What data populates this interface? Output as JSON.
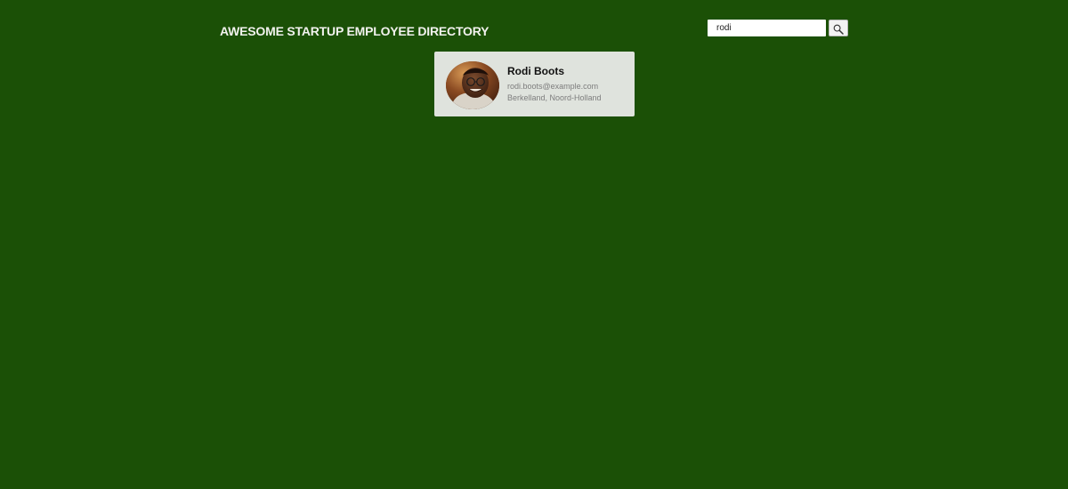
{
  "header": {
    "title": "AWESOME STARTUP EMPLOYEE DIRECTORY"
  },
  "search": {
    "value": "rodi",
    "button_icon": "magnifier-icon"
  },
  "results": [
    {
      "name": "Rodi Boots",
      "email": "rodi.boots@example.com",
      "location": "Berkelland, Noord-Holland"
    }
  ],
  "colors": {
    "background": "#1b5006",
    "card": "#dfe3dd",
    "title_text": "#f2f2ee",
    "secondary_text": "#7d7d7d"
  }
}
